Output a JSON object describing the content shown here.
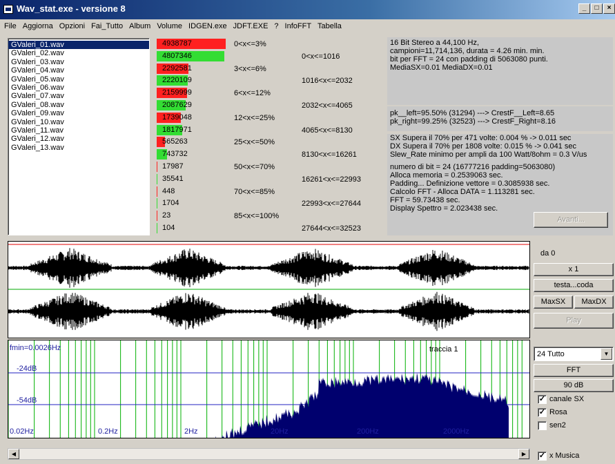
{
  "window": {
    "title": "Wav_stat.exe - versione 8"
  },
  "menu": [
    "File",
    "Aggiorna",
    "Opzioni",
    "Fai_Tutto",
    "Album",
    "Volume",
    "IDGEN.exe",
    "JDFT.EXE",
    "?",
    "InfoFFT",
    "Tabella"
  ],
  "files": {
    "selected_index": 0,
    "items": [
      "GValeri_01.wav",
      "GValeri_02.wav",
      "GValeri_03.wav",
      "GValeri_04.wav",
      "GValeri_05.wav",
      "GValeri_06.wav",
      "GValeri_07.wav",
      "GValeri_08.wav",
      "GValeri_09.wav",
      "GValeri_10.wav",
      "GValeri_11.wav",
      "GValeri_12.wav",
      "GValeri_13.wav"
    ]
  },
  "histogram": {
    "rows": [
      {
        "value": "4938787",
        "color": "#ff2020",
        "fill": 1.0
      },
      {
        "value": "4807346",
        "color": "#33dd33",
        "fill": 0.98
      },
      {
        "value": "2292581",
        "color": "#ff2020",
        "fill": 0.46
      },
      {
        "value": "2220109",
        "color": "#33dd33",
        "fill": 0.45
      },
      {
        "value": "2159999",
        "color": "#ff2020",
        "fill": 0.44
      },
      {
        "value": "2087629",
        "color": "#33dd33",
        "fill": 0.42
      },
      {
        "value": "1739048",
        "color": "#ff2020",
        "fill": 0.35
      },
      {
        "value": "1817971",
        "color": "#33dd33",
        "fill": 0.37
      },
      {
        "value": "565263",
        "color": "#ff2020",
        "fill": 0.12
      },
      {
        "value": "743732",
        "color": "#33dd33",
        "fill": 0.15
      },
      {
        "value": "17987",
        "color": "#ff2020",
        "fill": 0.004
      },
      {
        "value": "35541",
        "color": "#33dd33",
        "fill": 0.007
      },
      {
        "value": "448",
        "color": "#ff2020",
        "fill": 0.001
      },
      {
        "value": "1704",
        "color": "#33dd33",
        "fill": 0.001
      },
      {
        "value": "23",
        "color": "#ff2020",
        "fill": 0.0
      },
      {
        "value": "104",
        "color": "#33dd33",
        "fill": 0.0
      }
    ],
    "pct_labels": [
      "0<x<=3%",
      "3<x<=6%",
      "6<x<=12%",
      "12<x<=25%",
      "25<x<=50%",
      "50<x<=70%",
      "70<x<=85%",
      "85<x<=100%"
    ],
    "range_labels": [
      "0<x<=1016",
      "1016<x<=2032",
      "2032<x<=4065",
      "4065<x<=8130",
      "8130<x<=16261",
      "16261<x<=22993",
      "22993<x<=27644",
      "27644<x<=32523"
    ]
  },
  "info": {
    "block1": [
      "16 Bit Stereo a 44,100 Hz,",
      "campioni=11,714,136, durata = 4.26 min. min.",
      "bit per FFT = 24 con padding di 5063080 punti.",
      "MediaSX=0.01  MediaDX=0.01"
    ],
    "block2": [
      "pk__left=95.50% (31294) ---> CrestF__Left=8.65",
      "pk_right=99.25% (32523) ---> CrestF_Right=8.16"
    ],
    "block3": [
      "SX Supera il 70% per 471 volte: 0.004 % -> 0.011 sec",
      "DX Supera il 70% per 1808 volte: 0.015 % -> 0.041 sec",
      "Slew_Rate minimo per ampli da 100 Watt/8ohm = 0.3 V/us"
    ],
    "block4": [
      "numero di bit = 24 (16777216 padding=5063080)",
      "Alloca memoria = 0.2539063 sec.",
      "Padding... Definizione vettore = 0.3085938 sec.",
      "Calcolo FFT - Alloca DATA  = 1.113281 sec.",
      "FFT  = 59.73438 sec.",
      "Display Spettro  = 2.023438 sec."
    ],
    "avanti_label": "Avanti..."
  },
  "controls": {
    "da_label": "da 0",
    "x1_label": "x 1",
    "testa_coda_label": "testa...coda",
    "maxsx_label": "MaxSX",
    "maxdx_label": "MaxDX",
    "play_label": "Play",
    "combo_value": "24 Tutto",
    "fft_label": "FFT",
    "db_label": "90 dB",
    "canale_sx": {
      "label": "canale SX",
      "checked": true
    },
    "rosa": {
      "label": "Rosa",
      "checked": true
    },
    "sen2": {
      "label": "sen2",
      "checked": false
    },
    "x_musica": {
      "label": "x Musica",
      "checked": true
    }
  },
  "spectrum": {
    "fmin_label": "fmin=0.0026Hz",
    "traccia_label": "traccia 1",
    "db_labels": [
      "-24dB",
      "-54dB"
    ],
    "freq_labels": [
      "0.02Hz",
      "0.2Hz",
      "2Hz",
      "20Hz",
      "200Hz",
      "2000Hz"
    ]
  },
  "colors": {
    "bar_red": "#ff2020",
    "bar_green": "#33dd33",
    "spectrum": "#00006e",
    "gridline": "#00b000",
    "dbline": "#2020c0"
  }
}
